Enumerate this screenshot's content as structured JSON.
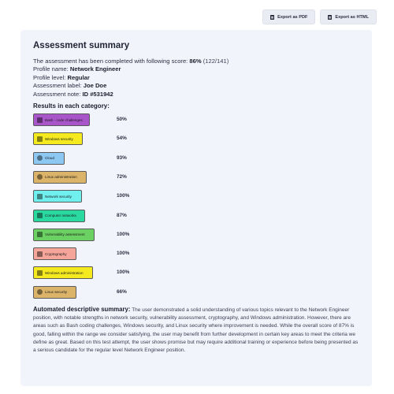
{
  "toolbar": {
    "export_pdf_label": "Export as PDF",
    "export_html_label": "Export as HTML"
  },
  "summary": {
    "title": "Assessment summary",
    "completed_text": "The assessment has been completed with following score:",
    "score_percent": "86%",
    "score_raw": "(122/141)",
    "profile_name_label": "Profile name:",
    "profile_name": "Network Engineer",
    "profile_level_label": "Profile level:",
    "profile_level": "Regular",
    "assessment_label_label": "Assessment label:",
    "assessment_label": "Joe Doe",
    "assessment_note_label": "Assessment note:",
    "assessment_note": "ID #531942"
  },
  "results": {
    "heading": "Results in each category:",
    "categories": [
      {
        "label": "Bash - code challenges",
        "percent": "50%",
        "color": "#a855c9",
        "icon": "code-icon"
      },
      {
        "label": "Windows security",
        "percent": "54%",
        "color": "#f4ea1f",
        "icon": "monitor-icon"
      },
      {
        "label": "Cloud",
        "percent": "93%",
        "color": "#8dc8f2",
        "icon": "cloud-icon"
      },
      {
        "label": "Linux administration",
        "percent": "72%",
        "color": "#dbb469",
        "icon": "penguin-icon"
      },
      {
        "label": "Network security",
        "percent": "100%",
        "color": "#6ff0ef",
        "icon": "network-icon"
      },
      {
        "label": "Computer networks",
        "percent": "87%",
        "color": "#2ad9a0",
        "icon": "network-icon"
      },
      {
        "label": "Vulnerability assessment",
        "percent": "100%",
        "color": "#6bd163",
        "icon": "shield-icon"
      },
      {
        "label": "Cryptography",
        "percent": "100%",
        "color": "#f6a59a",
        "icon": "key-icon"
      },
      {
        "label": "Windows administration",
        "percent": "100%",
        "color": "#f4ea1f",
        "icon": "monitor-icon"
      },
      {
        "label": "Linux security",
        "percent": "66%",
        "color": "#dbb469",
        "icon": "penguin-icon"
      }
    ]
  },
  "descriptive": {
    "heading": "Automated descriptive summary",
    "text": "The user demonstrated a solid understanding of various topics relevant to the Network Engineer position, with notable strengths in network security, vulnerability assessment, cryptography, and Windows administration. However, there are areas such as Bash coding challenges, Windows security, and Linux security where improvement is needed. While the overall score of 87% is good, falling within the range we consider satisfying, the user may benefit from further development in certain key areas to meet the criteria we define as great. Based on this test attempt, the user shows promise but may require additional training or experience before being presented as a serious candidate for the regular level Network Engineer position."
  }
}
